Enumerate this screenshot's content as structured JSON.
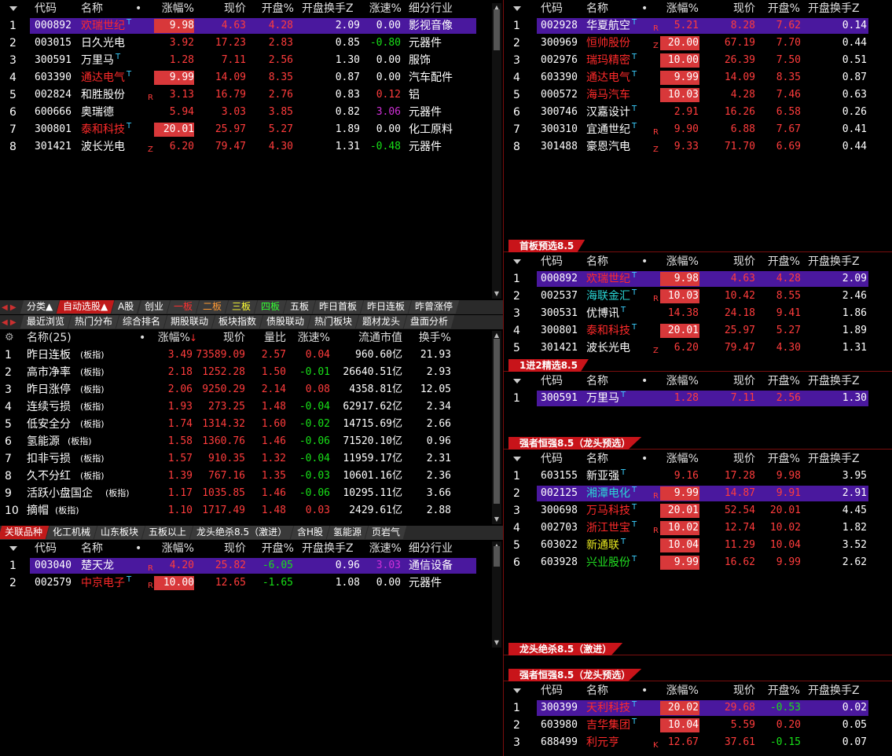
{
  "colors": {
    "accent": "#c8141a",
    "select": "#4a189e",
    "up": "#ff3c3c",
    "down": "#18e018"
  },
  "p1": {
    "headers": [
      "代码",
      "名称",
      "•",
      "涨幅%",
      "现价",
      "开盘%",
      "开盘换手Z",
      "涨速%",
      "细分行业"
    ],
    "rows": [
      {
        "i": "1",
        "code": "000892",
        "name": "欢瑞世纪",
        "nc": "nred",
        "t": true,
        "flag": "",
        "chg": "9.98",
        "box": true,
        "price": "4.63",
        "open": "4.28",
        "oc": "red",
        "turn": "2.09",
        "spd": "0.00",
        "sc": "wht",
        "ind": "影视音像",
        "sel": true
      },
      {
        "i": "2",
        "code": "003015",
        "name": "日久光电",
        "nc": "wht",
        "t": false,
        "flag": "",
        "chg": "3.92",
        "box": false,
        "price": "17.23",
        "open": "2.83",
        "oc": "red",
        "turn": "0.85",
        "spd": "-0.80",
        "sc": "grn",
        "ind": "元器件"
      },
      {
        "i": "3",
        "code": "300591",
        "name": "万里马",
        "nc": "wht",
        "t": true,
        "flag": "",
        "chg": "1.28",
        "box": false,
        "price": "7.11",
        "open": "2.56",
        "oc": "red",
        "turn": "1.30",
        "spd": "0.00",
        "sc": "wht",
        "ind": "服饰"
      },
      {
        "i": "4",
        "code": "603390",
        "name": "通达电气",
        "nc": "nred",
        "t": true,
        "flag": "",
        "chg": "9.99",
        "box": true,
        "price": "14.09",
        "open": "8.35",
        "oc": "red",
        "turn": "0.87",
        "spd": "0.00",
        "sc": "wht",
        "ind": "汽车配件"
      },
      {
        "i": "5",
        "code": "002824",
        "name": "和胜股份",
        "nc": "wht",
        "t": false,
        "flag": "R",
        "chg": "3.13",
        "box": false,
        "price": "16.79",
        "open": "2.76",
        "oc": "red",
        "turn": "0.83",
        "spd": "0.12",
        "sc": "red",
        "ind": "铝"
      },
      {
        "i": "6",
        "code": "600666",
        "name": "奥瑞德",
        "nc": "wht",
        "t": false,
        "flag": "",
        "chg": "5.94",
        "box": false,
        "price": "3.03",
        "open": "3.85",
        "oc": "red",
        "turn": "0.82",
        "spd": "3.06",
        "sc": "mag",
        "ind": "元器件"
      },
      {
        "i": "7",
        "code": "300801",
        "name": "泰和科技",
        "nc": "nred",
        "t": true,
        "flag": "",
        "chg": "20.01",
        "box": true,
        "price": "25.97",
        "open": "5.27",
        "oc": "red",
        "turn": "1.89",
        "spd": "0.00",
        "sc": "wht",
        "ind": "化工原料"
      },
      {
        "i": "8",
        "code": "301421",
        "name": "波长光电",
        "nc": "wht",
        "t": false,
        "flag": "Z",
        "chg": "6.20",
        "box": false,
        "price": "79.47",
        "open": "4.30",
        "oc": "red",
        "turn": "1.31",
        "spd": "-0.48",
        "sc": "grn",
        "ind": "元器件"
      }
    ]
  },
  "tabs1": [
    "分类▲",
    "自动选股▲",
    "A股",
    "创业",
    "一板",
    "二板",
    "三板",
    "四板",
    "五板",
    "昨日首板",
    "昨日连板",
    "昨曾涨停"
  ],
  "tabs2": [
    "最近浏览",
    "热门分布",
    "综合排名",
    "期股联动",
    "板块指数",
    "债股联动",
    "热门板块",
    "题材龙头",
    "盘面分析"
  ],
  "p2": {
    "headers": [
      "名称(25)",
      "•",
      "涨幅%",
      "现价",
      "量比",
      "涨速%",
      "流通市值",
      "换手%"
    ],
    "rows": [
      {
        "i": "1",
        "name": "昨日连板",
        "chg": "3.49",
        "price": "73589.09",
        "vr": "2.57",
        "spd": "0.04",
        "sc": "red",
        "cap": "960.60亿",
        "turn": "21.93"
      },
      {
        "i": "2",
        "name": "高市净率",
        "chg": "2.18",
        "price": "1252.28",
        "vr": "1.50",
        "spd": "-0.01",
        "sc": "grn",
        "cap": "26640.51亿",
        "turn": "2.93"
      },
      {
        "i": "3",
        "name": "昨日涨停",
        "chg": "2.06",
        "price": "9250.29",
        "vr": "2.14",
        "spd": "0.08",
        "sc": "red",
        "cap": "4358.81亿",
        "turn": "12.05"
      },
      {
        "i": "4",
        "name": "连续亏损",
        "chg": "1.93",
        "price": "273.25",
        "vr": "1.48",
        "spd": "-0.04",
        "sc": "grn",
        "cap": "62917.62亿",
        "turn": "2.34"
      },
      {
        "i": "5",
        "name": "低安全分",
        "chg": "1.74",
        "price": "1314.32",
        "vr": "1.60",
        "spd": "-0.02",
        "sc": "grn",
        "cap": "14715.69亿",
        "turn": "2.66"
      },
      {
        "i": "6",
        "name": "氢能源",
        "chg": "1.58",
        "price": "1360.76",
        "vr": "1.46",
        "spd": "-0.06",
        "sc": "grn",
        "cap": "71520.10亿",
        "turn": "0.96"
      },
      {
        "i": "7",
        "name": "扣非亏损",
        "chg": "1.57",
        "price": "910.35",
        "vr": "1.32",
        "spd": "-0.04",
        "sc": "grn",
        "cap": "11959.17亿",
        "turn": "2.31"
      },
      {
        "i": "8",
        "name": "久不分红",
        "chg": "1.39",
        "price": "767.16",
        "vr": "1.35",
        "spd": "-0.03",
        "sc": "grn",
        "cap": "10601.16亿",
        "turn": "2.36"
      },
      {
        "i": "9",
        "name": "活跃小盘国企",
        "chg": "1.17",
        "price": "1035.85",
        "vr": "1.46",
        "spd": "-0.06",
        "sc": "grn",
        "cap": "10295.11亿",
        "turn": "3.66"
      },
      {
        "i": "10",
        "name": "摘帽",
        "chg": "1.10",
        "price": "1717.49",
        "vr": "1.48",
        "spd": "0.03",
        "sc": "red",
        "cap": "2429.61亿",
        "turn": "2.88"
      }
    ],
    "tag": "(板指)"
  },
  "tabs3": [
    "关联品种",
    "化工机械",
    "山东板块",
    "五板以上",
    "龙头绝杀8.5（激进）",
    "含H股",
    "氢能源",
    "页岩气"
  ],
  "p3": {
    "headers": [
      "代码",
      "名称",
      "•",
      "涨幅%",
      "现价",
      "开盘%",
      "开盘换手Z",
      "涨速%",
      "细分行业"
    ],
    "rows": [
      {
        "i": "1",
        "code": "003040",
        "name": "楚天龙",
        "nc": "wht",
        "t": false,
        "flag": "R",
        "chg": "4.20",
        "box": false,
        "price": "25.82",
        "open": "-6.05",
        "oc": "grn",
        "turn": "0.96",
        "spd": "3.03",
        "sc": "mag",
        "ind": "通信设备",
        "sel": true
      },
      {
        "i": "2",
        "code": "002579",
        "name": "中京电子",
        "nc": "nred",
        "t": true,
        "flag": "R",
        "chg": "10.00",
        "box": true,
        "price": "12.65",
        "open": "-1.65",
        "oc": "grn",
        "turn": "1.08",
        "spd": "0.00",
        "sc": "wht",
        "ind": "元器件"
      }
    ]
  },
  "r_headers": [
    "代码",
    "名称",
    "•",
    "涨幅%",
    "现价",
    "开盘%",
    "开盘换手Z"
  ],
  "r1": [
    {
      "i": "1",
      "code": "002928",
      "name": "华夏航空",
      "nc": "wht",
      "t": true,
      "flag": "R",
      "chg": "5.21",
      "box": false,
      "price": "8.28",
      "open": "7.62",
      "turn": "0.14",
      "sel": true
    },
    {
      "i": "2",
      "code": "300969",
      "name": "恒帅股份",
      "nc": "nred",
      "t": false,
      "flag": "Z",
      "chg": "20.00",
      "box": true,
      "price": "67.19",
      "open": "7.70",
      "turn": "0.44"
    },
    {
      "i": "3",
      "code": "002976",
      "name": "瑞玛精密",
      "nc": "nred",
      "t": true,
      "flag": "",
      "chg": "10.00",
      "box": true,
      "price": "26.39",
      "open": "7.50",
      "turn": "0.51"
    },
    {
      "i": "4",
      "code": "603390",
      "name": "通达电气",
      "nc": "nred",
      "t": true,
      "flag": "",
      "chg": "9.99",
      "box": true,
      "price": "14.09",
      "open": "8.35",
      "turn": "0.87"
    },
    {
      "i": "5",
      "code": "000572",
      "name": "海马汽车",
      "nc": "nred",
      "t": false,
      "flag": "",
      "chg": "10.03",
      "box": true,
      "price": "4.28",
      "open": "7.46",
      "turn": "0.63"
    },
    {
      "i": "6",
      "code": "300746",
      "name": "汉嘉设计",
      "nc": "wht",
      "t": true,
      "flag": "",
      "chg": "2.91",
      "box": false,
      "price": "16.26",
      "open": "6.58",
      "turn": "0.26"
    },
    {
      "i": "7",
      "code": "300310",
      "name": "宜通世纪",
      "nc": "wht",
      "t": true,
      "flag": "R",
      "chg": "9.90",
      "box": false,
      "price": "6.88",
      "open": "7.67",
      "turn": "0.41"
    },
    {
      "i": "8",
      "code": "301488",
      "name": "豪恩汽电",
      "nc": "wht",
      "t": false,
      "flag": "Z",
      "chg": "9.33",
      "box": false,
      "price": "71.70",
      "open": "6.69",
      "turn": "0.44"
    }
  ],
  "r2title": "首板预选8.5",
  "r2": [
    {
      "i": "1",
      "code": "000892",
      "name": "欢瑞世纪",
      "nc": "nred",
      "t": true,
      "flag": "",
      "chg": "9.98",
      "box": true,
      "price": "4.63",
      "open": "4.28",
      "turn": "2.09",
      "sel": true
    },
    {
      "i": "2",
      "code": "002537",
      "name": "海联金汇",
      "nc": "ncyan",
      "t": true,
      "flag": "R",
      "chg": "10.03",
      "box": true,
      "price": "10.42",
      "open": "8.55",
      "turn": "2.46"
    },
    {
      "i": "3",
      "code": "300531",
      "name": "优博讯",
      "nc": "wht",
      "t": true,
      "flag": "",
      "chg": "14.38",
      "box": false,
      "price": "24.18",
      "open": "9.41",
      "turn": "1.86"
    },
    {
      "i": "4",
      "code": "300801",
      "name": "泰和科技",
      "nc": "nred",
      "t": true,
      "flag": "",
      "chg": "20.01",
      "box": true,
      "price": "25.97",
      "open": "5.27",
      "turn": "1.89"
    },
    {
      "i": "5",
      "code": "301421",
      "name": "波长光电",
      "nc": "wht",
      "t": false,
      "flag": "Z",
      "chg": "6.20",
      "box": false,
      "price": "79.47",
      "open": "4.30",
      "turn": "1.31"
    }
  ],
  "r3title": "1进2精选8.5",
  "r3": [
    {
      "i": "1",
      "code": "300591",
      "name": "万里马",
      "nc": "wht",
      "t": true,
      "flag": "",
      "chg": "1.28",
      "box": false,
      "price": "7.11",
      "open": "2.56",
      "turn": "1.30",
      "sel": true
    }
  ],
  "r4title": "强者恒强8.5（龙头预选）",
  "r4": [
    {
      "i": "1",
      "code": "603155",
      "name": "新亚强",
      "nc": "wht",
      "t": true,
      "flag": "",
      "chg": "9.16",
      "box": false,
      "price": "17.28",
      "open": "9.98",
      "turn": "3.95"
    },
    {
      "i": "2",
      "code": "002125",
      "name": "湘潭电化",
      "nc": "ncyan",
      "t": true,
      "flag": "R",
      "chg": "9.99",
      "box": true,
      "price": "14.87",
      "open": "9.91",
      "turn": "2.91",
      "sel": true
    },
    {
      "i": "3",
      "code": "300698",
      "name": "万马科技",
      "nc": "nred",
      "t": true,
      "flag": "",
      "chg": "20.01",
      "box": true,
      "price": "52.54",
      "open": "20.01",
      "turn": "4.45"
    },
    {
      "i": "4",
      "code": "002703",
      "name": "浙江世宝",
      "nc": "nred",
      "t": true,
      "flag": "R",
      "chg": "10.02",
      "box": true,
      "price": "12.74",
      "open": "10.02",
      "turn": "1.82"
    },
    {
      "i": "5",
      "code": "603022",
      "name": "新通联",
      "nc": "nyel",
      "t": true,
      "flag": "",
      "chg": "10.04",
      "box": true,
      "price": "11.29",
      "open": "10.04",
      "turn": "3.52"
    },
    {
      "i": "6",
      "code": "603928",
      "name": "兴业股份",
      "nc": "ngrn",
      "t": true,
      "flag": "",
      "chg": "9.99",
      "box": true,
      "price": "16.62",
      "open": "9.99",
      "turn": "2.62"
    }
  ],
  "r5title": "龙头绝杀8.5（激进）",
  "r6title": "强者恒强8.5（龙头预选）",
  "r6": [
    {
      "i": "1",
      "code": "300399",
      "name": "天利科技",
      "nc": "nred",
      "t": true,
      "flag": "",
      "chg": "20.02",
      "box": true,
      "price": "29.68",
      "open": "-0.53",
      "oc": "grn",
      "turn": "0.02",
      "sel": true
    },
    {
      "i": "2",
      "code": "603980",
      "name": "吉华集团",
      "nc": "nred",
      "t": true,
      "flag": "",
      "chg": "10.04",
      "box": true,
      "price": "5.59",
      "open": "0.20",
      "turn": "0.05"
    },
    {
      "i": "3",
      "code": "688499",
      "name": "利元亨",
      "nc": "nred",
      "t": false,
      "flag": "K",
      "chg": "12.67",
      "box": false,
      "price": "37.61",
      "open": "-0.15",
      "oc": "grn",
      "turn": "0.07"
    }
  ]
}
